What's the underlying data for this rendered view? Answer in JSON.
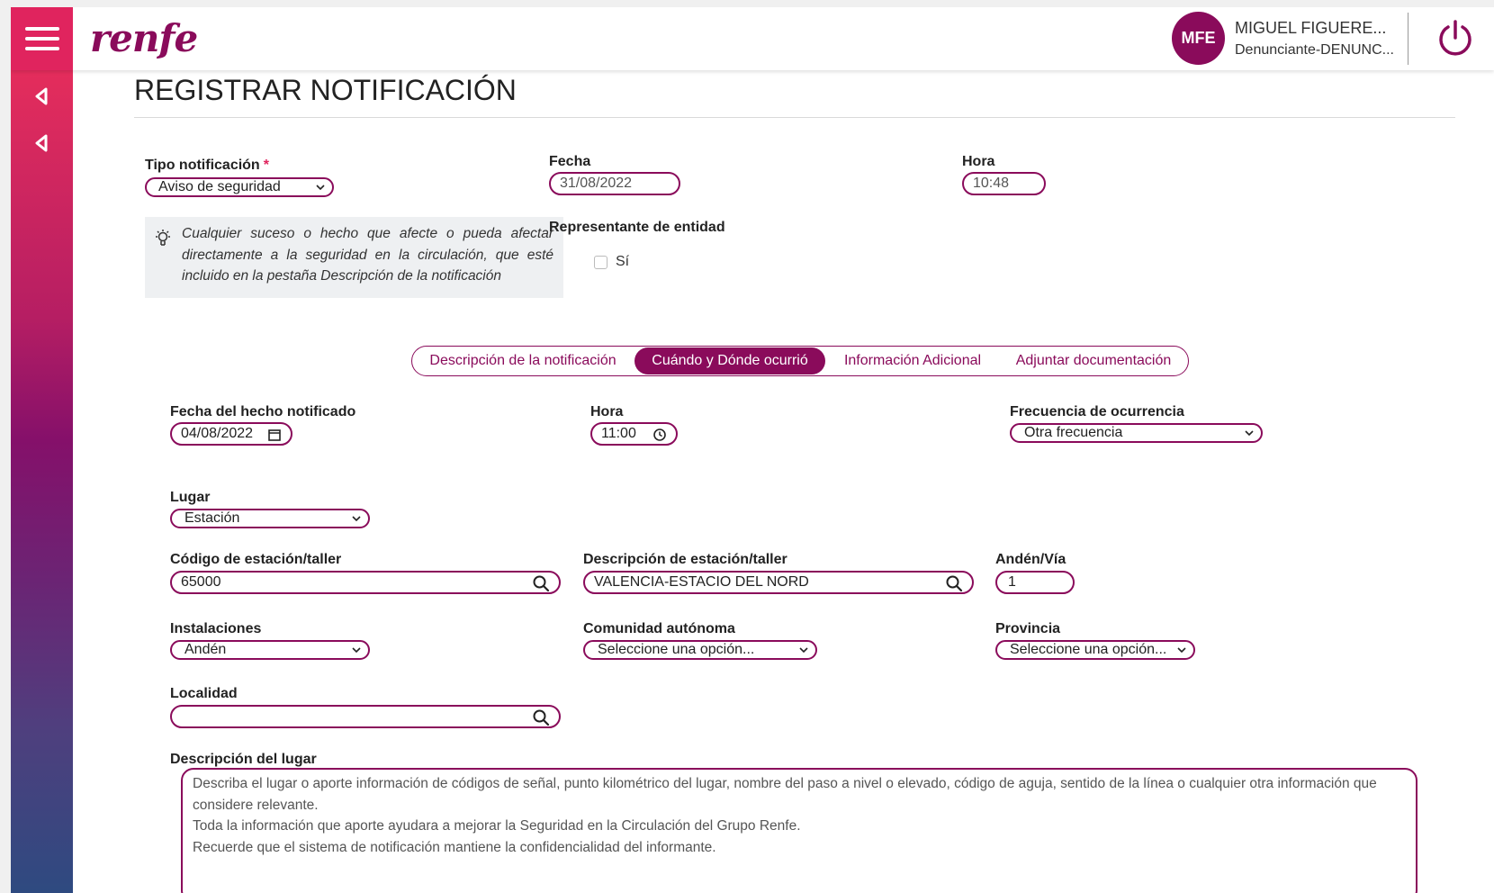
{
  "header": {
    "logo": "renfe",
    "user_initials": "MFE",
    "user_name": "MIGUEL FIGUERE...",
    "user_role": "Denunciante-DENUNC..."
  },
  "colors": {
    "brand": "#8a0b5b",
    "accent": "#e0245e"
  },
  "page": {
    "title": "REGISTRAR NOTIFICACIÓN"
  },
  "form": {
    "tipo_label": "Tipo notificación",
    "tipo_required": "*",
    "tipo_value": "Aviso de seguridad",
    "fecha_label": "Fecha",
    "fecha_value": "31/08/2022",
    "hora_label": "Hora",
    "hora_value": "10:48",
    "info_text": "Cualquier suceso o hecho que afecte o pueda afectar directamente a la seguridad en la circulación, que esté incluido en la pestaña Descripción de la notificación",
    "representante_label": "Representante de entidad",
    "representante_option": "Sí",
    "representante_checked": false
  },
  "tabs": [
    {
      "label": "Descripción de la notificación",
      "active": false
    },
    {
      "label": "Cuándo y Dónde ocurrió",
      "active": true
    },
    {
      "label": "Información Adicional",
      "active": false
    },
    {
      "label": "Adjuntar documentación",
      "active": false
    }
  ],
  "details": {
    "fecha_hecho_label": "Fecha del hecho notificado",
    "fecha_hecho_value": "04/08/2022",
    "hora_label": "Hora",
    "hora_value": "11:00",
    "frecuencia_label": "Frecuencia de ocurrencia",
    "frecuencia_value": "Otra frecuencia",
    "lugar_label": "Lugar",
    "lugar_value": "Estación",
    "codigo_label": "Código de estación/taller",
    "codigo_value": "65000",
    "descripcion_estacion_label": "Descripción de estación/taller",
    "descripcion_estacion_value": "VALENCIA-ESTACIO DEL NORD",
    "anden_label": "Andén/Vía",
    "anden_value": "1",
    "instalaciones_label": "Instalaciones",
    "instalaciones_value": "Andén",
    "comunidad_label": "Comunidad autónoma",
    "comunidad_value": "Seleccione una opción...",
    "provincia_label": "Provincia",
    "provincia_value": "Seleccione una opción...",
    "localidad_label": "Localidad",
    "localidad_value": "",
    "descripcion_lugar_label": "Descripción del lugar",
    "descripcion_lugar_lines": [
      "Describa el lugar o aporte información de códigos de señal, punto kilométrico del lugar, nombre del paso a nivel o elevado, código de aguja, sentido de la línea o cualquier otra información que considere relevante.",
      "Toda la información que aporte ayudara a mejorar la Seguridad en la Circulación del Grupo Renfe.",
      "Recuerde que el sistema de notificación mantiene la confidencialidad del informante."
    ]
  }
}
